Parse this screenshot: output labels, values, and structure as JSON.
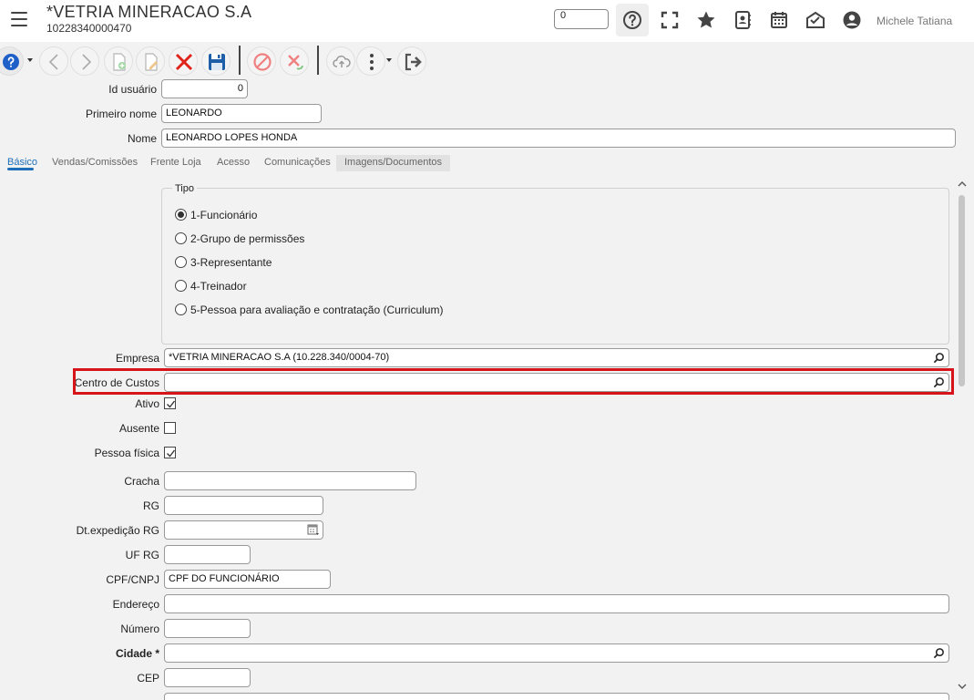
{
  "header": {
    "title": "*VETRIA MINERACAO S.A",
    "subtitle": "10228340000470",
    "counter_value": "0",
    "user_name": "Michele Tatiana"
  },
  "form": {
    "id_usuario": {
      "label": "Id usuário",
      "value": "0"
    },
    "primeiro_nome": {
      "label": "Primeiro nome",
      "value": "LEONARDO"
    },
    "nome": {
      "label": "Nome",
      "value": "LEONARDO LOPES HONDA"
    }
  },
  "tabs": [
    {
      "label": "Básico"
    },
    {
      "label": "Vendas/Comissões"
    },
    {
      "label": "Frente Loja"
    },
    {
      "label": "Acesso"
    },
    {
      "label": "Comunicações"
    },
    {
      "label": "Imagens/Documentos"
    }
  ],
  "tipo": {
    "legend": "Tipo",
    "options": [
      {
        "label": "1-Funcionário",
        "selected": true
      },
      {
        "label": "2-Grupo de permissões",
        "selected": false
      },
      {
        "label": "3-Representante",
        "selected": false
      },
      {
        "label": "4-Treinador",
        "selected": false
      },
      {
        "label": "5-Pessoa para avaliação e contratação (Curriculum)",
        "selected": false
      }
    ]
  },
  "fields": {
    "empresa": {
      "label": "Empresa",
      "value": "*VETRIA MINERACAO S.A (10.228.340/0004-70)"
    },
    "centro_custos": {
      "label": "Centro de Custos",
      "value": ""
    },
    "ativo": {
      "label": "Ativo",
      "checked": true
    },
    "ausente": {
      "label": "Ausente",
      "checked": false
    },
    "pessoa_fisica": {
      "label": "Pessoa física",
      "checked": true
    },
    "cracha": {
      "label": "Cracha",
      "value": ""
    },
    "rg": {
      "label": "RG",
      "value": ""
    },
    "dt_expedicao_rg": {
      "label": "Dt.expedição RG",
      "value": ""
    },
    "uf_rg": {
      "label": "UF RG",
      "value": ""
    },
    "cpf_cnpj": {
      "label": "CPF/CNPJ",
      "value": "CPF DO FUNCIONÁRIO"
    },
    "endereco": {
      "label": "Endereço",
      "value": ""
    },
    "numero": {
      "label": "Número",
      "value": ""
    },
    "cidade": {
      "label": "Cidade *",
      "value": ""
    },
    "cep": {
      "label": "CEP",
      "value": ""
    }
  },
  "colors": {
    "accent": "#1f6fb8",
    "highlight": "#d8141b",
    "delete": "#e0241b",
    "save": "#1f5fa8"
  }
}
